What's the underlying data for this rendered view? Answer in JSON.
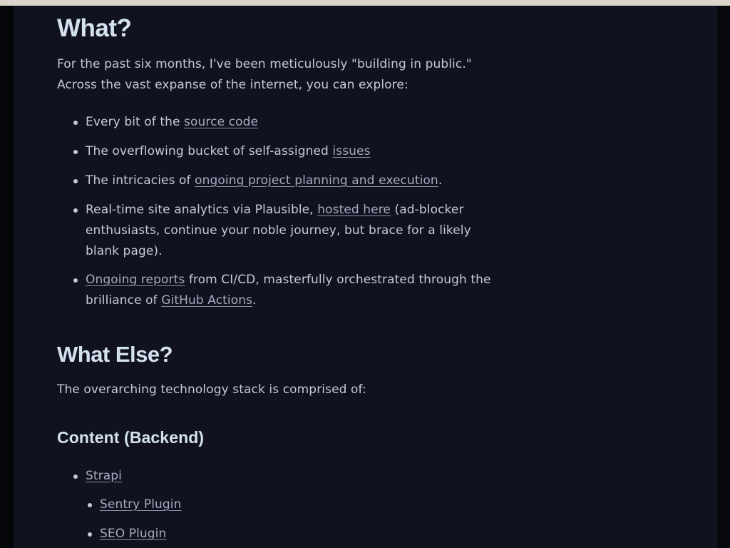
{
  "what": {
    "heading": "What?",
    "intro": "For the past six months, I've been meticulously \"building in public.\" Across the vast expanse of the internet, you can explore:",
    "items": [
      {
        "before": "Every bit of the ",
        "link": "source code",
        "after": ""
      },
      {
        "before": "The overflowing bucket of self-assigned ",
        "link": "issues",
        "after": ""
      },
      {
        "before": "The intricacies of ",
        "link": "ongoing project planning and execution",
        "after": "."
      },
      {
        "before": "Real-time site analytics via Plausible, ",
        "link": "hosted here",
        "after": " (ad-blocker enthusiasts, continue your noble journey, but brace for a likely blank page)."
      },
      {
        "link": "Ongoing reports",
        "middle": " from CI/CD, masterfully orchestrated through the brilliance of ",
        "link2": "GitHub Actions",
        "after": "."
      }
    ]
  },
  "what_else": {
    "heading": "What Else?",
    "intro": "The overarching technology stack is comprised of:"
  },
  "content_backend": {
    "heading": "Content (Backend)",
    "items": [
      {
        "link": "Strapi"
      },
      {
        "link": "Sentry Plugin"
      },
      {
        "link": "SEO Plugin"
      }
    ]
  }
}
